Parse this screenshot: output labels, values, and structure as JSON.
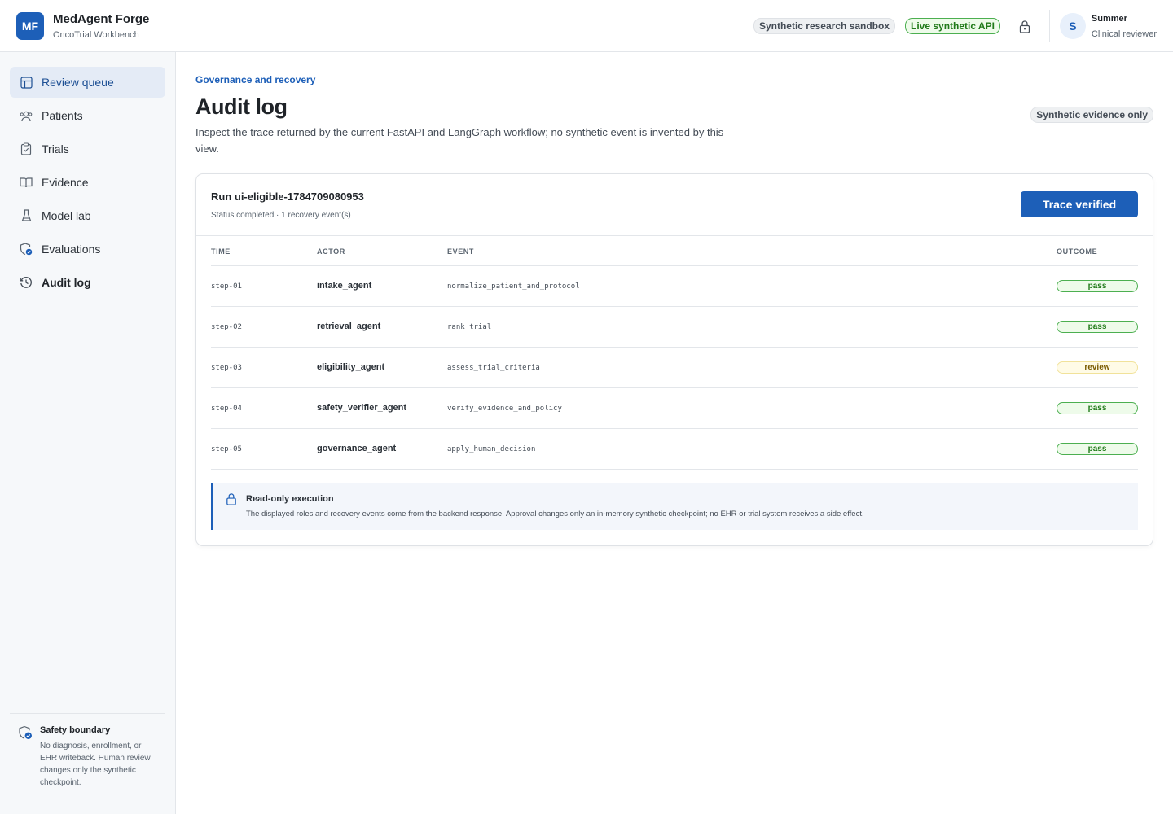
{
  "header": {
    "logo_text": "MF",
    "app_title": "MedAgent Forge",
    "app_subtitle": "OncoTrial Workbench",
    "badges": [
      "Synthetic research sandbox",
      "Live synthetic API"
    ],
    "user": {
      "initial": "S",
      "name": "Summer",
      "role": "Clinical reviewer"
    }
  },
  "sidebar": {
    "items": [
      {
        "label": "Review queue",
        "icon": "layout-icon"
      },
      {
        "label": "Patients",
        "icon": "users-icon"
      },
      {
        "label": "Trials",
        "icon": "clipboard-icon"
      },
      {
        "label": "Evidence",
        "icon": "book-icon"
      },
      {
        "label": "Model lab",
        "icon": "flask-icon"
      },
      {
        "label": "Evaluations",
        "icon": "shield-check-icon"
      },
      {
        "label": "Audit log",
        "icon": "history-icon"
      }
    ],
    "safety": {
      "title": "Safety boundary",
      "text": "No diagnosis, enrollment, or EHR writeback. Human review changes only the synthetic checkpoint."
    }
  },
  "page": {
    "kicker": "Governance and recovery",
    "title": "Audit log",
    "description": "Inspect the trace returned by the current FastAPI and LangGraph workflow; no synthetic event is invented by this view.",
    "evidence_badge": "Synthetic evidence only"
  },
  "run": {
    "title": "Run ui-eligible-1784709080953",
    "status": "Status completed · 1 recovery event(s)",
    "verify_label": "Trace verified"
  },
  "table": {
    "headers": {
      "time": "TIME",
      "actor": "ACTOR",
      "event": "EVENT",
      "outcome": "OUTCOME"
    },
    "rows": [
      {
        "time": "step-01",
        "actor": "intake_agent",
        "event": "normalize_patient_and_protocol",
        "outcome": "pass"
      },
      {
        "time": "step-02",
        "actor": "retrieval_agent",
        "event": "rank_trial",
        "outcome": "pass"
      },
      {
        "time": "step-03",
        "actor": "eligibility_agent",
        "event": "assess_trial_criteria",
        "outcome": "review"
      },
      {
        "time": "step-04",
        "actor": "safety_verifier_agent",
        "event": "verify_evidence_and_policy",
        "outcome": "pass"
      },
      {
        "time": "step-05",
        "actor": "governance_agent",
        "event": "apply_human_decision",
        "outcome": "pass"
      }
    ]
  },
  "notice": {
    "title": "Read-only execution",
    "text": "The displayed roles and recovery events come from the backend response. Approval changes only an in-memory synthetic checkpoint; no EHR or trial system receives a side effect."
  },
  "colors": {
    "accent": "#1d5fb8",
    "pass": "#217a1a",
    "review": "#7a5b00"
  }
}
